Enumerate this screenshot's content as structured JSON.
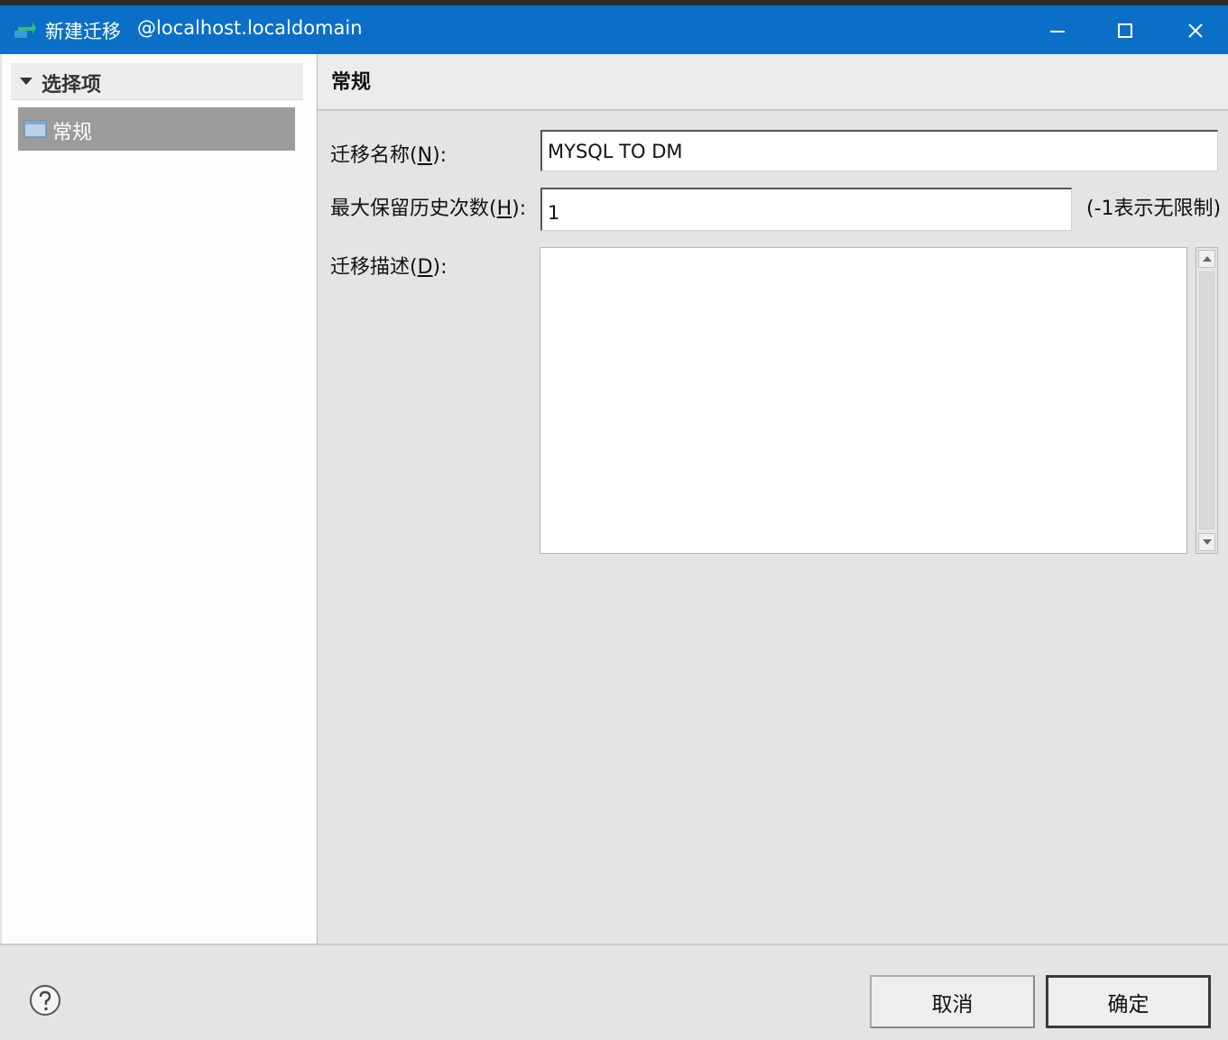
{
  "window": {
    "title": "新建迁移",
    "host": "@localhost.localdomain",
    "controls": {
      "minimize": "minimize-icon",
      "maximize": "maximize-icon",
      "close": "close-icon"
    }
  },
  "sidebar": {
    "header_label": "选择项",
    "items": [
      {
        "label": "常规",
        "selected": true
      }
    ]
  },
  "section": {
    "title": "常规"
  },
  "form": {
    "name_label_pre": "迁移名称(",
    "name_label_key": "N",
    "name_label_post": "):",
    "name_value": "MYSQL TO DM",
    "history_label_pre": "最大保留历史次数(",
    "history_label_key": "H",
    "history_label_post": "):",
    "history_value": "1",
    "history_hint": "(-1表示无限制)",
    "desc_label_pre": "迁移描述(",
    "desc_label_key": "D",
    "desc_label_post": "):",
    "desc_value": ""
  },
  "footer": {
    "cancel_label": "取消",
    "ok_label": "确定",
    "help_icon": "help-icon"
  },
  "colors": {
    "titlebar": "#0b6fc7",
    "selected_item": "#9c9c9c",
    "panel_bg": "#e4e4e2"
  }
}
